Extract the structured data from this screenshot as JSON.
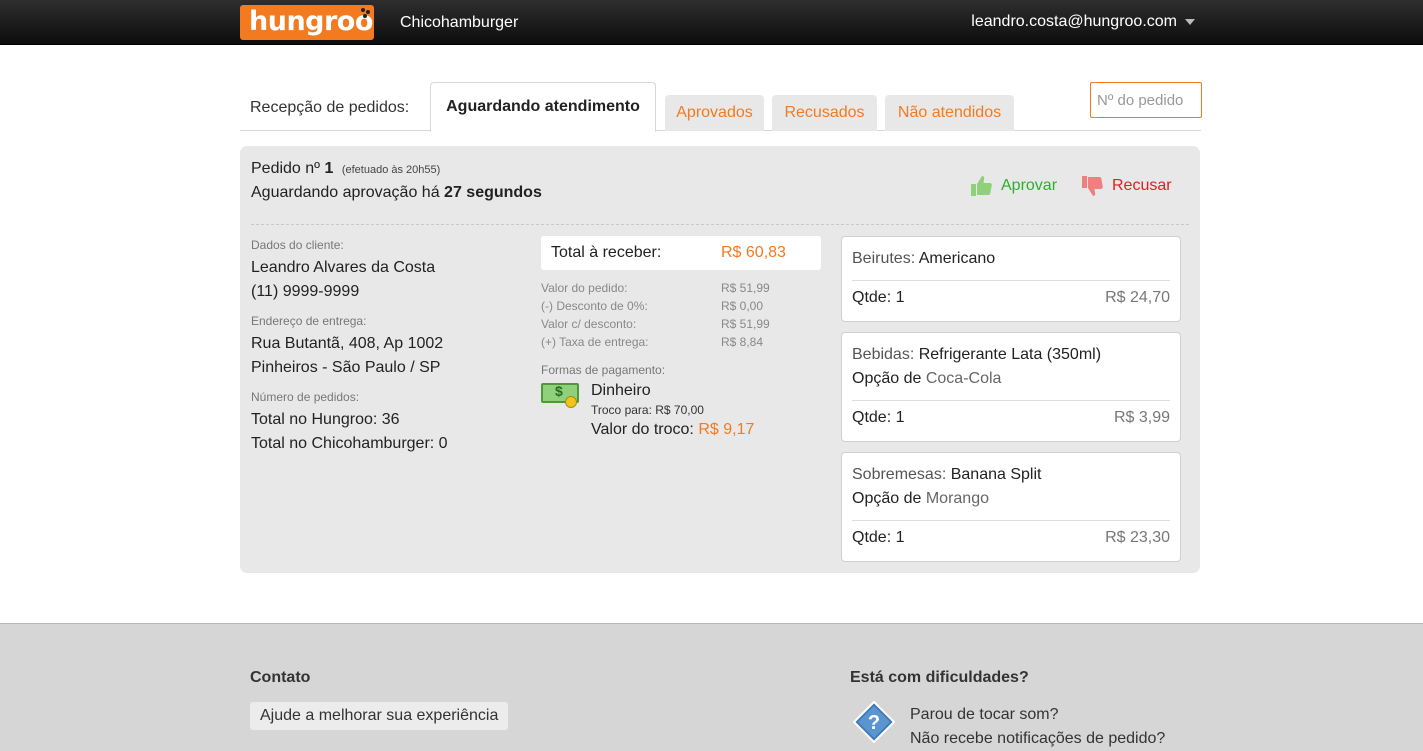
{
  "header": {
    "logo_text": "hungroo",
    "store_name": "Chicohamburger",
    "user_email": "leandro.costa@hungroo.com"
  },
  "tabs": {
    "label": "Recepção de pedidos:",
    "items": [
      {
        "label": "Aguardando atendimento",
        "active": true
      },
      {
        "label": "Aprovados",
        "active": false
      },
      {
        "label": "Recusados",
        "active": false
      },
      {
        "label": "Não atendidos",
        "active": false
      }
    ],
    "order_search_placeholder": "Nº do pedido"
  },
  "order": {
    "title_prefix": "Pedido nº",
    "number": "1",
    "placed_at": "(efetuado às 20h55)",
    "waiting_prefix": "Aguardando aprovação há",
    "waiting_time": "27 segundos",
    "approve_label": "Aprovar",
    "refuse_label": "Recusar",
    "customer": {
      "label": "Dados do cliente:",
      "name": "Leandro Alvares da Costa",
      "phone": "(11) 9999-9999"
    },
    "address": {
      "label": "Endereço de entrega:",
      "line1": "Rua Butantã, 408, Ap 1002",
      "line2": "Pinheiros - São Paulo / SP"
    },
    "orders_count": {
      "label": "Número de pedidos:",
      "hungroo": "Total no Hungroo: 36",
      "store": "Total no Chicohamburger: 0"
    },
    "total": {
      "label": "Total à receber:",
      "amount": "R$ 60,83"
    },
    "breakdown": [
      {
        "label": "Valor do pedido:",
        "value": "R$ 51,99"
      },
      {
        "label": "(-) Desconto de 0%:",
        "value": "R$ 0,00"
      },
      {
        "label": "Valor c/ desconto:",
        "value": "R$ 51,99"
      },
      {
        "label": "(+) Taxa de entrega:",
        "value": "R$ 8,84"
      }
    ],
    "payment": {
      "label": "Formas de pagamento:",
      "method": "Dinheiro",
      "change_for": "Troco para: R$ 70,00",
      "change_label": "Valor do troco:",
      "change_amount": "R$ 9,17"
    },
    "items": [
      {
        "category": "Beirutes:",
        "name": "Americano",
        "option_prefix": "",
        "option": "",
        "qty": "Qtde: 1",
        "price": "R$ 24,70"
      },
      {
        "category": "Bebidas:",
        "name": "Refrigerante Lata (350ml)",
        "option_prefix": "Opção de",
        "option": "Coca-Cola",
        "qty": "Qtde: 1",
        "price": "R$ 3,99"
      },
      {
        "category": "Sobremesas:",
        "name": "Banana Split",
        "option_prefix": "Opção de",
        "option": "Morango",
        "qty": "Qtde: 1",
        "price": "R$ 23,30"
      }
    ]
  },
  "footer": {
    "contact_title": "Contato",
    "feedback_button": "Ajude a melhorar sua experiência",
    "help_title": "Está com dificuldades?",
    "help_link1": "Parou de tocar som?",
    "help_link2": "Não recebe notificações de pedido?"
  },
  "colors": {
    "accent": "#f47a20",
    "approve": "#2bb02b",
    "refuse": "#e02020"
  }
}
